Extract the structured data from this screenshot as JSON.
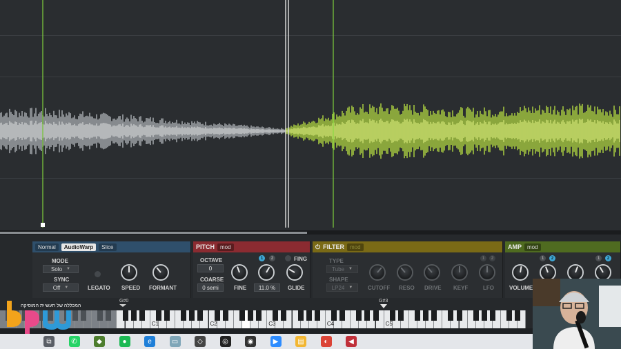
{
  "slice_modes": {
    "normal": "Normal",
    "audiowarp": "AudioWarp",
    "slice": "Slice"
  },
  "sample": {
    "mode_label": "MODE",
    "mode_value": "Solo",
    "sync_label": "SYNC",
    "sync_value": "Off",
    "legato_label": "LEGATO",
    "speed_label": "SPEED",
    "formant_label": "FORMANT"
  },
  "pitch": {
    "title": "PITCH",
    "mod": "mod",
    "octave_label": "OCTAVE",
    "octave_value": "0",
    "coarse_label": "COARSE",
    "coarse_value": "0 semi",
    "fine_label": "FINE",
    "fine_value": "11.0 %",
    "glide_label": "GLIDE",
    "fing_label": "FING",
    "badge1": "1",
    "badge2": "2"
  },
  "filter": {
    "title": "FILTER",
    "mod": "mod",
    "type_label": "TYPE",
    "type_value": "Tube",
    "shape_label": "SHAPE",
    "shape_value": "LP24",
    "cutoff_label": "CUTOFF",
    "reso_label": "RESO",
    "drive_label": "DRIVE",
    "keyf_label": "KEYF",
    "lfo_label": "LFO",
    "badge1": "1",
    "badge2": "2"
  },
  "amp": {
    "title": "AMP",
    "mod": "mod",
    "volume_label": "VOLUME",
    "badge1": "1",
    "badge2": "2",
    "badge3": "1",
    "badge4": "2"
  },
  "keyboard": {
    "low_flag": "G#0",
    "root_flag": "G#3",
    "octaves": [
      "C1",
      "C2",
      "C3",
      "C4",
      "C5"
    ]
  },
  "logo_tagline": "המכללה של תעשיית המוסיקה",
  "taskbar_icons": [
    "task-view-icon",
    "whatsapp-icon",
    "dropbox-icon",
    "spotify-icon",
    "edge-icon",
    "cam-icon",
    "unity-icon",
    "obs-icon",
    "obs-alt-icon",
    "zoom-icon",
    "folder-icon",
    "chrome-icon",
    "cubase-icon"
  ],
  "colors": {
    "sample_section": "#2f4f6b",
    "pitch_section": "#8b2b31",
    "filter_section": "#7a6a16",
    "amp_section": "#4f6b20",
    "waveform_gray": "#9ea2a6",
    "waveform_green": "#a3c440",
    "root_key": "#3fa8d6"
  }
}
